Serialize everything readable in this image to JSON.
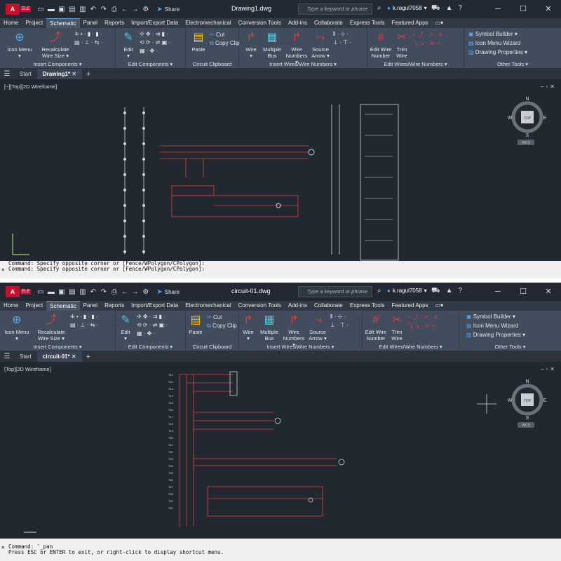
{
  "window1": {
    "doc_title": "Drawing1.dwg",
    "file_tab": "Drawing1*",
    "viewport_label": "[−][Top][2D Wireframe]",
    "command_lines": [
      "Command: Specify opposite corner or [Fence/WPolygon/CPolygon]:",
      "Command: Specify opposite corner or [Fence/WPolygon/CPolygon]:"
    ]
  },
  "window2": {
    "doc_title": "circuit-01.dwg",
    "file_tab": "circuit-01*",
    "viewport_label": "[Top][2D Wireframe]",
    "command_lines": [
      "Command: '_pan",
      "Press ESC or ENTER to exit, or right-click to display shortcut menu."
    ]
  },
  "common": {
    "share_label": "Share",
    "search_placeholder": "Type a keyword or phrase",
    "username": "k.ragul7058",
    "start_tab": "Start",
    "menu_tabs": [
      "Home",
      "Project",
      "Schematic",
      "Panel",
      "Reports",
      "Import/Export Data",
      "Electromechanical",
      "Conversion Tools",
      "Add-ins",
      "Collaborate",
      "Express Tools",
      "Featured Apps"
    ],
    "active_tab": "Schematic",
    "ribbon": {
      "icon_menu": "Icon Menu",
      "recalculate": "Recalculate",
      "wire_size": "Wire Size",
      "insert_components": "Insert Components",
      "edit": "Edit",
      "edit_components": "Edit Components",
      "paste": "Paste",
      "cut": "Cut",
      "copy_clip": "Copy Clip",
      "circuit_clipboard": "Circuit Clipboard",
      "wire": "Wire",
      "multiple": "Multiple",
      "bus": "Bus",
      "wire_numbers": "Wire",
      "numbers": "Numbers",
      "source": "Source",
      "arrow": "Arrow",
      "insert_wires": "Insert Wires/Wire Numbers",
      "edit_wire": "Edit Wire",
      "number": "Number",
      "trim": "Trim",
      "wire_l2": "Wire",
      "edit_wires": "Edit Wires/Wire Numbers",
      "symbol_builder": "Symbol Builder",
      "icon_menu_wizard": "Icon Menu  Wizard",
      "drawing_properties": "Drawing  Properties",
      "other_tools": "Other Tools"
    },
    "viewcube": {
      "n": "N",
      "s": "S",
      "e": "E",
      "w": "W",
      "top": "TOP",
      "wcs": "WCS"
    },
    "colors": {
      "title_bg": "#222933",
      "ribbon_bg": "#414c5c",
      "canvas_bg": "#212830",
      "wire_red": "#e23d3d",
      "accent_blue": "#4da3ff"
    }
  }
}
